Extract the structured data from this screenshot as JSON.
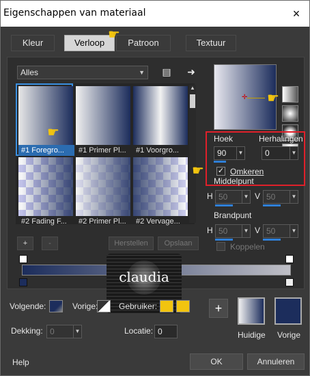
{
  "window": {
    "title": "Eigenschappen van materiaal",
    "close": "×"
  },
  "tabs": [
    "Kleur",
    "Verloop",
    "Patroon",
    "Textuur"
  ],
  "panel": {
    "category": "Alles",
    "thumbnails": [
      "#1 Foregro...",
      "#1 Primer Pl...",
      "#1 Voorgro...",
      "#2 Fading F...",
      "#2 Primer Pl...",
      "#2 Vervage..."
    ],
    "add_button": "+",
    "remove_button": "-",
    "restore_button": "Herstellen",
    "save_button": "Opslaan"
  },
  "angle": {
    "label": "Hoek",
    "value": "90"
  },
  "repeats": {
    "label": "Herhalingen",
    "value": "0"
  },
  "reverse": {
    "label": "Omkeren",
    "checked": true
  },
  "center": {
    "label": "Middelpunt",
    "h_label": "H",
    "h_value": "50",
    "v_label": "V",
    "v_value": "50"
  },
  "focal": {
    "label": "Brandpunt",
    "h_label": "H",
    "h_value": "50",
    "v_label": "V",
    "v_value": "50"
  },
  "link": {
    "label": "Koppelen"
  },
  "bottom": {
    "next_label": "Volgende:",
    "prev_label": "Vorige:",
    "user_label": "Gebruiker:",
    "opacity_label": "Dekking:",
    "opacity_value": "0",
    "location_label": "Locatie:",
    "location_value": "0",
    "plus": "+",
    "current_label": "Huidige",
    "previous_label": "Vorige"
  },
  "footer": {
    "help": "Help",
    "ok": "OK",
    "cancel": "Annuleren"
  },
  "logo": {
    "text": "claudia"
  },
  "colors": {
    "accent": "#2b6cb0",
    "navy": "#1c2d5c",
    "highlight": "#e0202a",
    "user_swatch": "#f2c40f"
  }
}
